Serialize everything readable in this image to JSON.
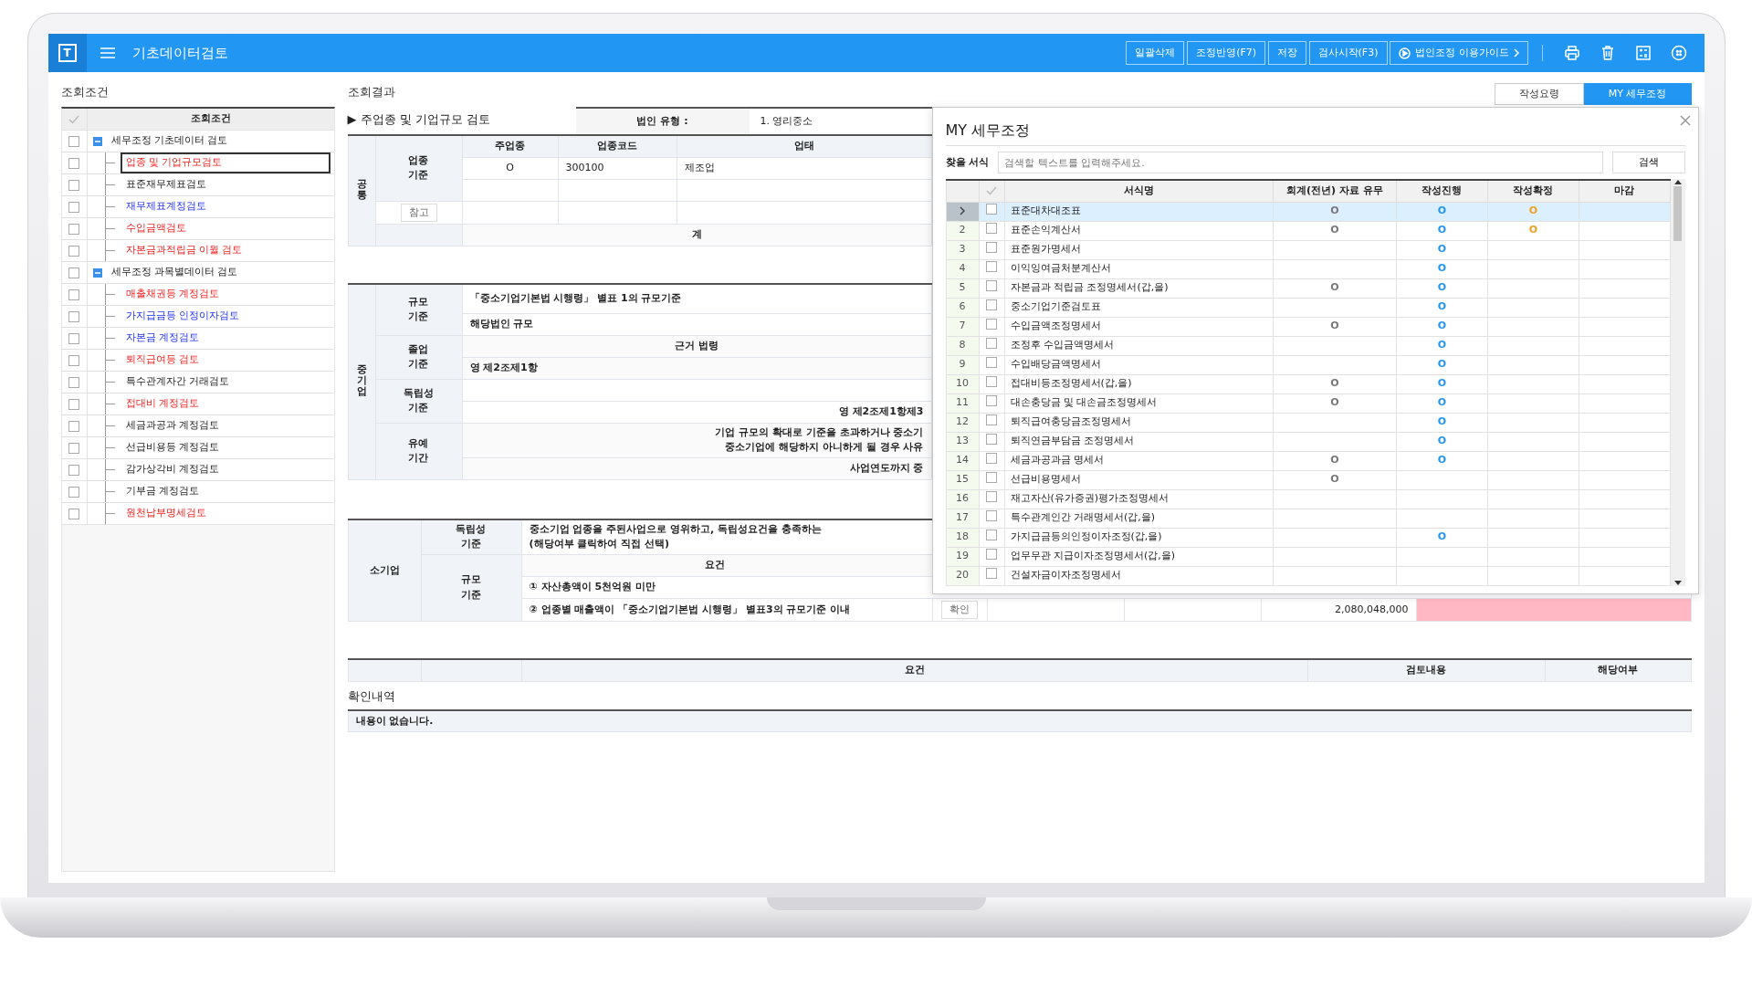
{
  "app_bar": {
    "logo": "T",
    "title": "기초데이터검토",
    "buttons": [
      {
        "label": "일괄삭제",
        "kind": "plain"
      },
      {
        "label": "조정반영(F7)",
        "kind": "plain"
      },
      {
        "label": "저장",
        "kind": "plain"
      },
      {
        "label": "검사시작(F3)",
        "kind": "plain"
      },
      {
        "label": "법인조정 이용가이드",
        "kind": "guide"
      }
    ]
  },
  "left_panel": {
    "heading": "조회조건",
    "column": "조회조건",
    "tree": [
      {
        "label": "세무조정 기초데이터 검토",
        "checked": false,
        "expanded": true,
        "children": [
          {
            "label": "업종 및 기업규모검토",
            "kind": "warning",
            "checked": false,
            "selected": true
          },
          {
            "label": "표준재무제표검토",
            "kind": "plain",
            "checked": false,
            "selected": false
          },
          {
            "label": "재무제표계정검토",
            "kind": "info",
            "checked": false,
            "selected": false
          },
          {
            "label": "수입금액검토",
            "kind": "warning",
            "checked": false,
            "selected": false
          },
          {
            "label": "자본금과적립금 이월 검토",
            "kind": "warning",
            "checked": false,
            "selected": false
          }
        ]
      },
      {
        "label": "세무조정 과목별데이터 검토",
        "checked": false,
        "expanded": true,
        "children": [
          {
            "label": "매출채권등 계정검토",
            "kind": "warning",
            "checked": false,
            "selected": false
          },
          {
            "label": "가지급금등 인정이자검토",
            "kind": "info",
            "checked": false,
            "selected": false
          },
          {
            "label": "자본금 계정검토",
            "kind": "info",
            "checked": false,
            "selected": false
          },
          {
            "label": "퇴직급여등 검토",
            "kind": "warning",
            "checked": false,
            "selected": false
          },
          {
            "label": "특수관계자간 거래검토",
            "kind": "plain",
            "checked": false,
            "selected": false
          },
          {
            "label": "접대비 계정검토",
            "kind": "warning",
            "checked": false,
            "selected": false
          },
          {
            "label": "세금과공과 계정검토",
            "kind": "plain",
            "checked": false,
            "selected": false
          },
          {
            "label": "선급비용등 계정검토",
            "kind": "plain",
            "checked": false,
            "selected": false
          },
          {
            "label": "감가상각비 계정검토",
            "kind": "plain",
            "checked": false,
            "selected": false
          },
          {
            "label": "기부금 계정검토",
            "kind": "plain",
            "checked": false,
            "selected": false
          },
          {
            "label": "원천납부명세검토",
            "kind": "warning",
            "checked": false,
            "selected": false
          }
        ]
      }
    ]
  },
  "result": {
    "heading": "조회결과",
    "section_title": "▶ 주업종 및 기업규모 검토",
    "corp_type_label": "법인 유형 :",
    "corp_type_value": "1. 영리중소",
    "common": {
      "group": "공통",
      "basis": "업종 기준",
      "columns": [
        "주업종",
        "업종코드",
        "업태"
      ],
      "rows": [
        [
          "O",
          "300100",
          "제조업"
        ]
      ],
      "reference_button": "참고",
      "total_label": "계"
    },
    "medium": {
      "group": "중기업",
      "sections": [
        {
          "label": "규모 기준",
          "lines": [
            {
              "text": "「중소기업기본법 시행령」 별표 1의 규모기준",
              "kind": "value"
            },
            {
              "text": "해당법인 규모",
              "kind": "value"
            }
          ]
        },
        {
          "label": "졸업 기준",
          "lines": [
            {
              "text": "근거 법령",
              "kind": "heading"
            },
            {
              "text": "영 제2조제1항",
              "kind": "value"
            }
          ]
        },
        {
          "label": "독립성 기준",
          "lines": [
            {
              "text": "영 제2조제1항제3",
              "kind": "trailing"
            }
          ]
        },
        {
          "label": "유예 기간",
          "lines": [
            {
              "text": "기업 규모의 확대로 기준을 초과하거나 중소기\n중소기업에 해당하지 아니하게 될 경우 사유",
              "kind": "trailing"
            },
            {
              "text": "사업연도까지 중",
              "kind": "trailing"
            }
          ]
        }
      ]
    },
    "small": {
      "group": "소기업",
      "independence": {
        "label": "독립성 기준",
        "text": "중소기업 업종을 주된사업으로 영위하고, 독립성요건을 충족하는\n(해당여부 클릭하여 직접 선택)"
      },
      "scale": {
        "label": "규모 기준",
        "heading": "요건",
        "criteria": [
          "① 자산총액이 5천억원 미만",
          "② 업종별 매출액이 「중소기업기본법 시행령」 별표3의 규모기준 이내"
        ],
        "check_button": "확인",
        "amount": "2,080,048,000",
        "color": "#ffb8c4"
      }
    },
    "review_columns": [
      "요건",
      "검토내용",
      "해당여부"
    ],
    "confirm": {
      "heading": "확인내역",
      "empty_text": "내용이 없습니다."
    }
  },
  "side_tabs": [
    {
      "label": "작성요령",
      "selected": false
    },
    {
      "label": "MY 세무조정",
      "selected": true
    }
  ],
  "dialog": {
    "title": "MY 세무조정",
    "search_label": "찾을 서식",
    "placeholder": "검색할 텍스트를 입력해주세요.",
    "search_button": "검색",
    "columns": [
      "서식명",
      "회계(전년) 자료 유무",
      "작성진행",
      "작성확정",
      "마감"
    ],
    "rows": [
      {
        "selected": true,
        "checked": false,
        "name": "표준대차대조표",
        "accounting": "O",
        "progress": "O",
        "confirmed": "O"
      },
      {
        "number": "2",
        "selected": false,
        "checked": false,
        "name": "표준손익계산서",
        "accounting": "O",
        "progress": "O",
        "confirmed": "O"
      },
      {
        "number": "3",
        "selected": false,
        "checked": false,
        "name": "표준원가명세서",
        "progress": "O"
      },
      {
        "number": "4",
        "selected": false,
        "checked": false,
        "name": "이익잉여금처분계산서",
        "progress": "O"
      },
      {
        "number": "5",
        "selected": false,
        "checked": false,
        "name": "자본금과 적립금 조정명세서(갑,을)",
        "accounting": "O",
        "progress": "O"
      },
      {
        "number": "6",
        "selected": false,
        "checked": false,
        "name": "중소기업기준검토표",
        "progress": "O"
      },
      {
        "number": "7",
        "selected": false,
        "checked": false,
        "name": "수입금액조정명세서",
        "accounting": "O",
        "progress": "O"
      },
      {
        "number": "8",
        "selected": false,
        "checked": false,
        "name": "조정후 수입금액명세서",
        "progress": "O"
      },
      {
        "number": "9",
        "selected": false,
        "checked": false,
        "name": "수입배당금액명세서",
        "progress": "O"
      },
      {
        "number": "10",
        "selected": false,
        "checked": false,
        "name": "접대비등조정명세서(갑,을)",
        "accounting": "O",
        "progress": "O"
      },
      {
        "number": "11",
        "selected": false,
        "checked": false,
        "name": "대손충당금 및 대손금조정명세서",
        "accounting": "O",
        "progress": "O"
      },
      {
        "number": "12",
        "selected": false,
        "checked": false,
        "name": "퇴직급여충당금조정명세서",
        "progress": "O"
      },
      {
        "number": "13",
        "selected": false,
        "checked": false,
        "name": "퇴직연금부담금 조정명세서",
        "progress": "O"
      },
      {
        "number": "14",
        "selected": false,
        "checked": false,
        "name": "세금과공과금 명세서",
        "accounting": "O",
        "progress": "O"
      },
      {
        "number": "15",
        "selected": false,
        "checked": false,
        "name": "선급비용명세서",
        "accounting": "O"
      },
      {
        "number": "16",
        "selected": false,
        "checked": false,
        "name": "재고자산(유가증권)평가조정명세서"
      },
      {
        "number": "17",
        "selected": false,
        "checked": false,
        "name": "특수관계인간 거래명세서(갑,을)"
      },
      {
        "number": "18",
        "selected": false,
        "checked": false,
        "name": "가지급금등의인정이자조정(갑,을)",
        "progress": "O"
      },
      {
        "number": "19",
        "selected": false,
        "checked": false,
        "name": "업무무관 지급이자조정명세서(갑,을)"
      },
      {
        "number": "20",
        "selected": false,
        "checked": false,
        "name": "건설자금이자조정명세서"
      }
    ]
  }
}
